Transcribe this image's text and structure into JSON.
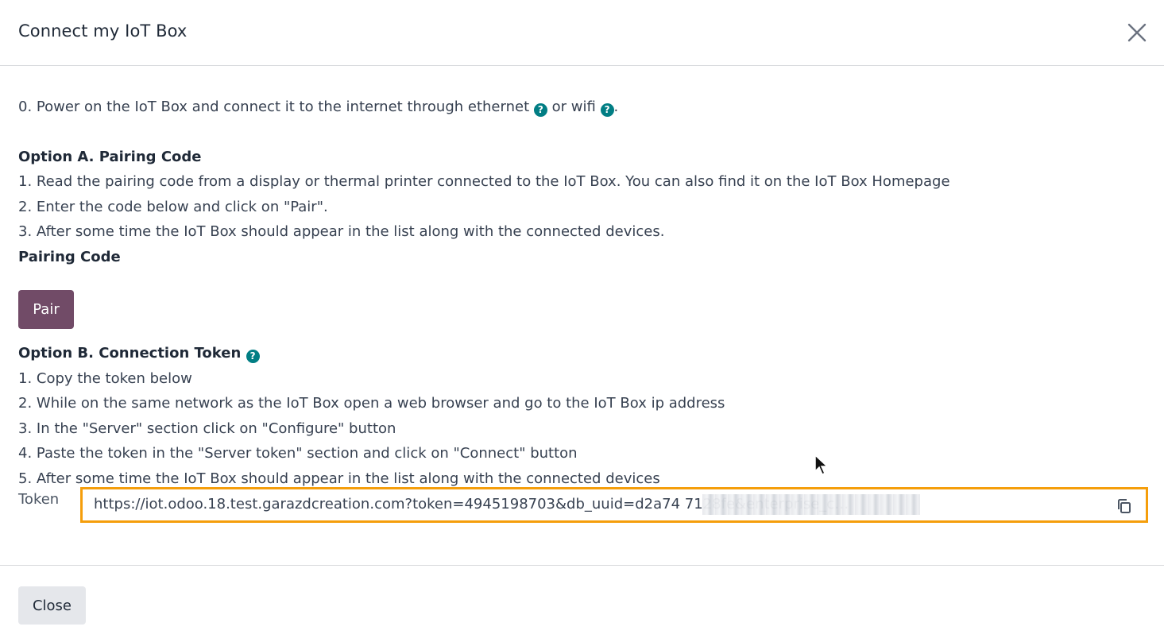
{
  "header": {
    "title": "Connect my IoT Box"
  },
  "body": {
    "intro_line": "0. Power on the IoT Box and connect it to the internet through ethernet",
    "intro_or": "or wifi",
    "intro_end": ".",
    "option_a": {
      "title": "Option A. Pairing Code",
      "steps": [
        "1. Read the pairing code from a display or thermal printer connected to the IoT Box. You can also find it on the IoT Box Homepage",
        "2. Enter the code below and click on \"Pair\".",
        "3. After some time the IoT Box should appear in the list along with the connected devices."
      ],
      "field_label": "Pairing Code",
      "pair_button": "Pair"
    },
    "option_b": {
      "title": "Option B. Connection Token",
      "steps": [
        "1. Copy the token below",
        "2. While on the same network as the IoT Box open a web browser and go to the IoT Box ip address",
        "3. In the \"Server\" section click on \"Configure\" button",
        "4. Paste the token in the \"Server token\" section and click on \"Connect\" button",
        "5. After some time the IoT Box should appear in the list along with the connected devices"
      ],
      "token_label": "Token",
      "token_value": "https://iot.odoo.18.test.garazdcreation.com?token=4945198703&db_uuid=d2a74                               7128fe&enterprise_c…"
    }
  },
  "footer": {
    "close_button": "Close"
  },
  "colors": {
    "primary": "#714b67",
    "help_icon": "#017e84",
    "highlight": "#f59e0b"
  },
  "icons": {
    "help": "question-circle-icon",
    "copy": "copy-icon",
    "close": "close-icon"
  }
}
